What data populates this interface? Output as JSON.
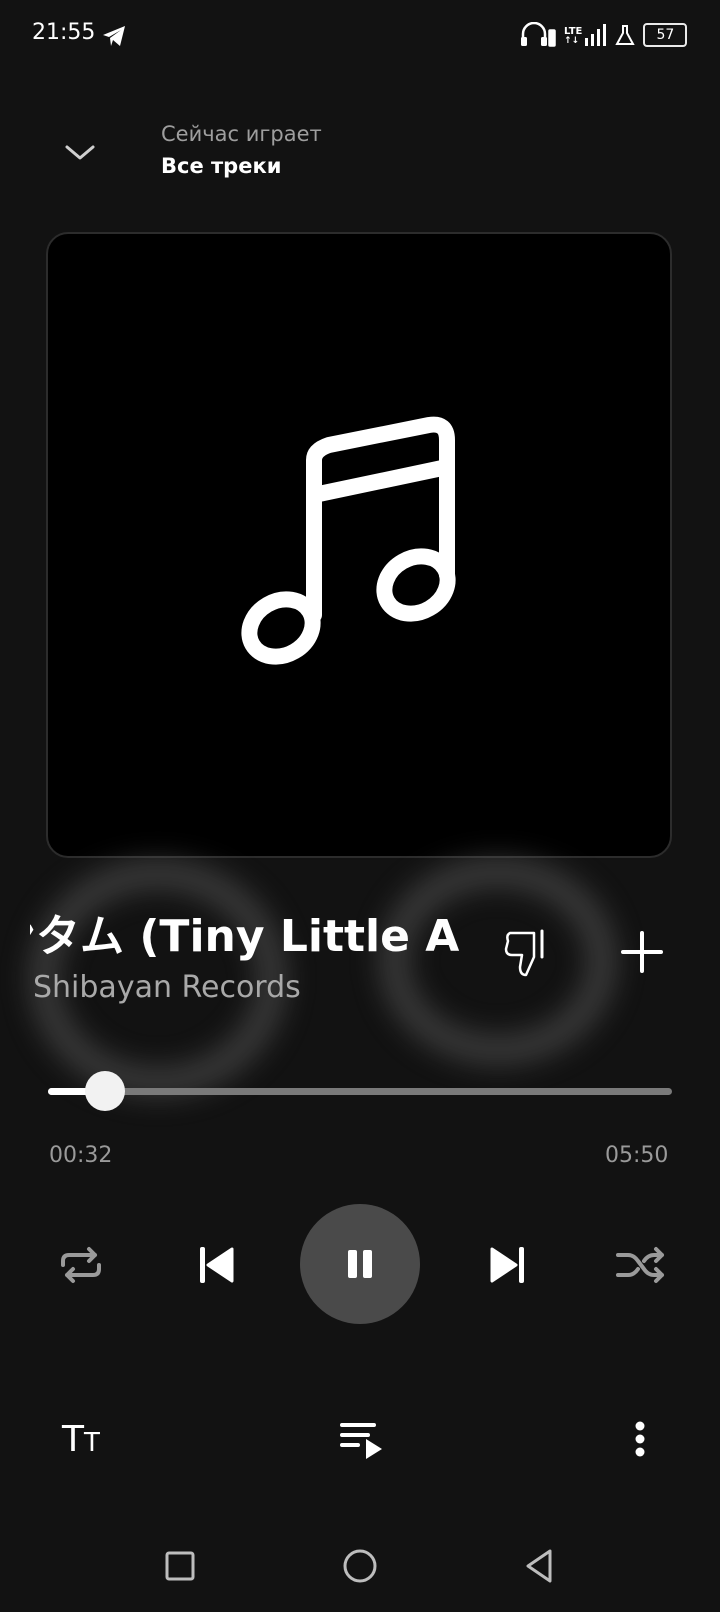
{
  "status_bar": {
    "time": "21:55",
    "battery": "57",
    "network": "LTE",
    "icons": [
      "telegram-icon",
      "headphones-battery-icon",
      "lte-signal-icon",
      "flask-icon",
      "battery-icon"
    ]
  },
  "header": {
    "subtitle": "Сейчас играет",
    "title": "Все треки"
  },
  "track": {
    "title": "ンタム (Tiny Little A",
    "artist": "Shibayan Records"
  },
  "playback": {
    "current_time": "00:32",
    "duration": "05:50",
    "progress": 0.0914,
    "state": "playing"
  },
  "controls": [
    "repeat-icon",
    "previous-icon",
    "pause-icon",
    "next-icon",
    "shuffle-icon"
  ],
  "bottom_actions": {
    "lyrics_big": "T",
    "lyrics_small": "T",
    "icons": [
      "lyrics-icon",
      "queue-icon",
      "more-icon"
    ]
  },
  "colors": {
    "background": "#121212",
    "artwork_bg": "#000000",
    "play_button": "#4a4a4a",
    "progress_track": "#7a7a7a",
    "progress_fill": "#ffffff",
    "secondary_text": "#9e9e9e"
  }
}
